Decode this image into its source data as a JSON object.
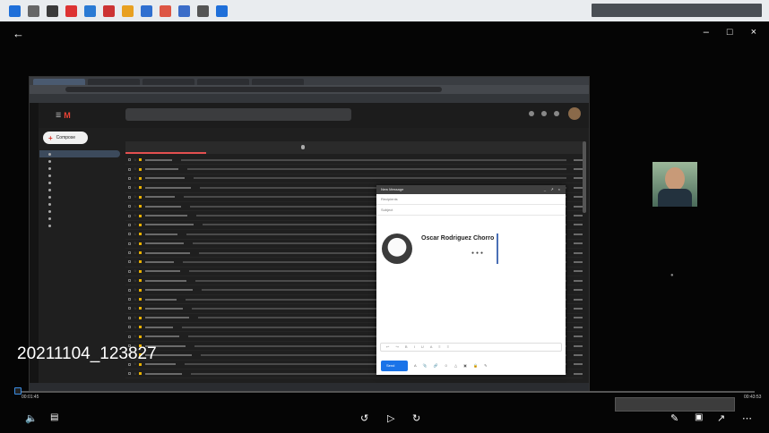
{
  "overlay": {
    "timestamp": "20211104_123827"
  },
  "compose": {
    "fab_label": "Compose"
  },
  "compose_window": {
    "title": "New Message",
    "to_placeholder": "Recipients",
    "subject_placeholder": "Subject",
    "send_label": "Send"
  },
  "signature": {
    "name": "Oscar Rodriguez Chorro"
  },
  "player": {
    "current_time": "00:01:45",
    "total_time": "00:43:53"
  },
  "colors": {
    "gmail_red": "#ea4335",
    "send_blue": "#1a73e8",
    "seek_blue": "#3a8ee6",
    "signature_blue": "#4a6fb5"
  }
}
